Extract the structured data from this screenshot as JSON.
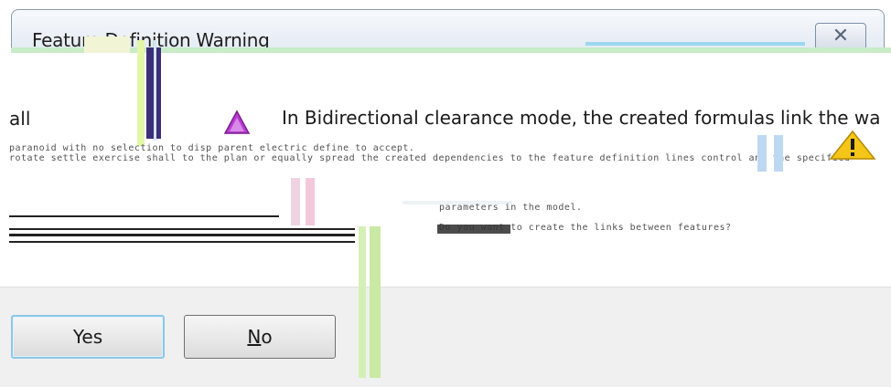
{
  "dialog": {
    "title": "Feature Definition Warning",
    "close_glyph": "✕",
    "message_fragment_left": "all",
    "message_main": "In Bidirectional clearance mode, the created formulas link the wa",
    "garbled_line_1": "paranoid with no selection to disp parent electric define to accept.",
    "garbled_line_2": "rotate settle exercise shall to the plan or equally spread the created dependencies to the feature definition lines control and the specified",
    "garbled_line_3": "parameters in the model.",
    "garbled_line_4": "Do you want to create the links between features?"
  },
  "buttons": {
    "yes_label": "Yes",
    "no_mnemonic": "N",
    "no_rest": "o"
  },
  "icons": {
    "warning_small": "warning-icon",
    "warning_big": "warning-icon",
    "close": "close-icon"
  },
  "colors": {
    "warning_yellow": "#f5c518",
    "warning_purple": "#9b2fb5",
    "default_button_border": "#8cc7e8"
  }
}
